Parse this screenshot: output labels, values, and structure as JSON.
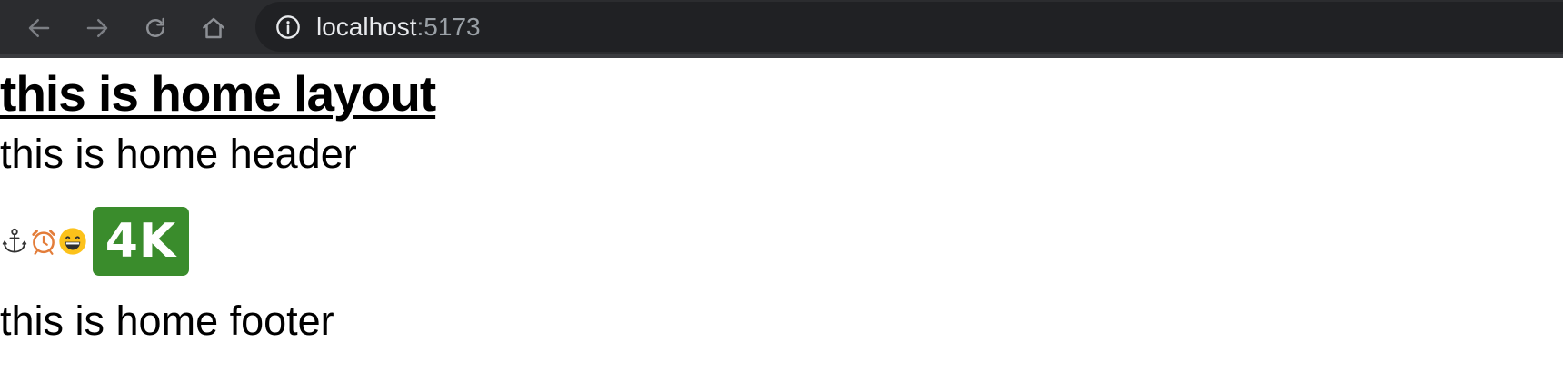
{
  "browser": {
    "url_host": "localhost",
    "url_port": ":5173",
    "icons": {
      "back": "arrow-left-icon",
      "forward": "arrow-right-icon",
      "reload": "reload-icon",
      "home": "home-icon",
      "info": "info-icon"
    }
  },
  "page": {
    "layout_title": "this is home layout",
    "header_text": "this is home header",
    "footer_text": "this is home footer",
    "emoji_row": {
      "anchor": "anchor-icon",
      "alarm_clock": "alarm-clock-icon",
      "grinning_face": "grinning-face-icon",
      "badge_label": "4K"
    }
  },
  "colors": {
    "toolbar_bg": "#2b2c2f",
    "omnibox_bg": "#202124",
    "badge_bg": "#3a8c2c"
  }
}
